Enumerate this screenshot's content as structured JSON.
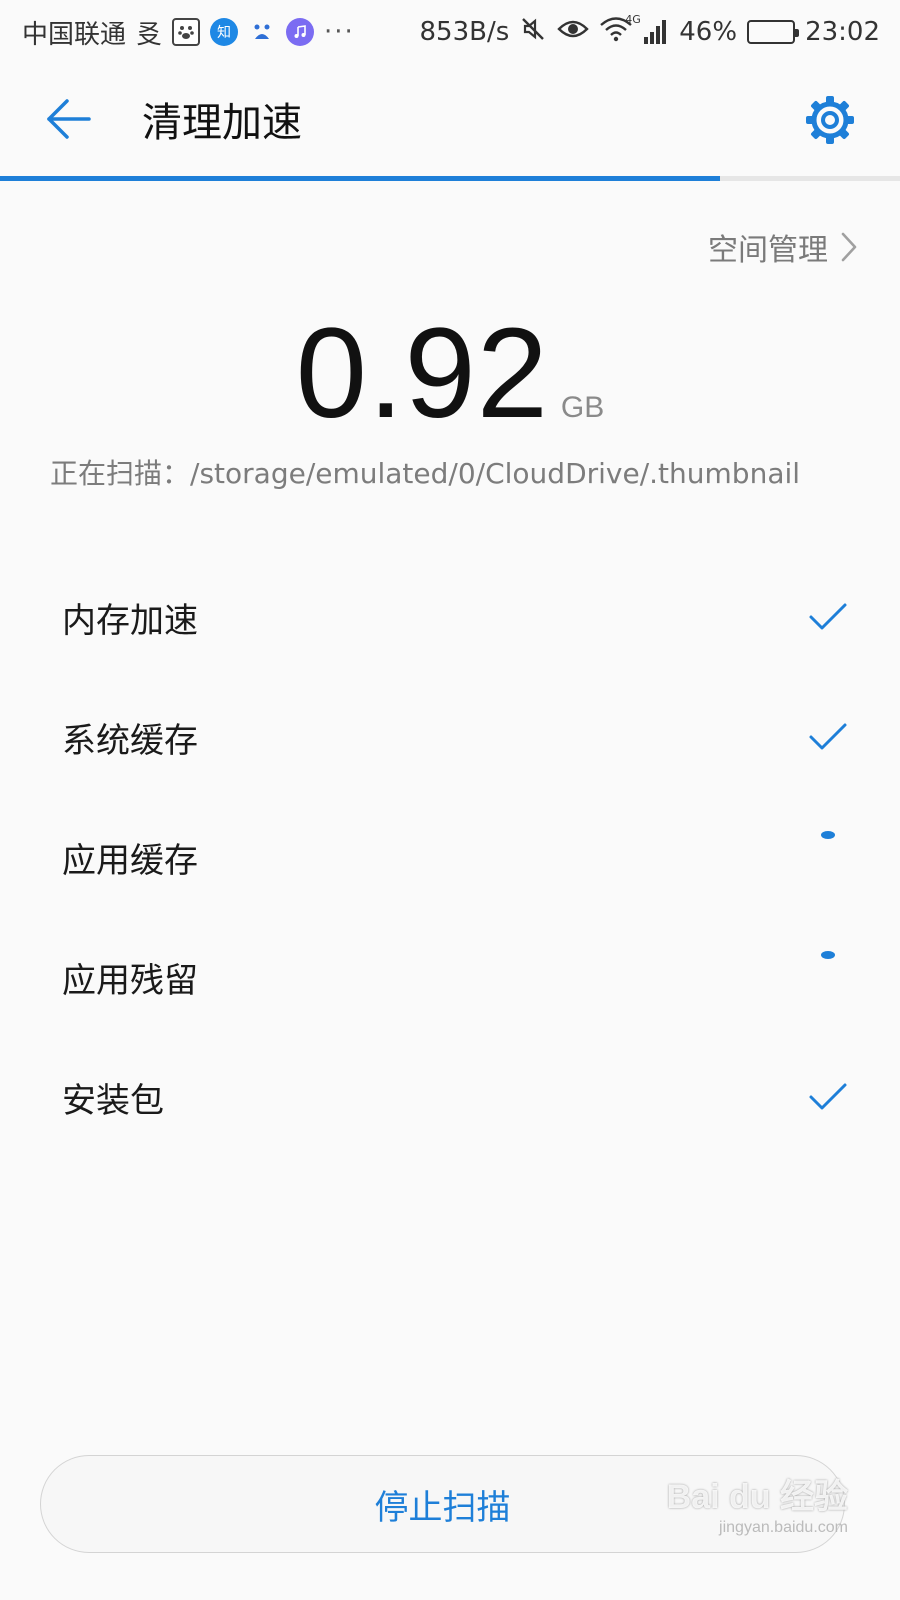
{
  "status_bar": {
    "carrier": "中国联通",
    "ime_glyph": "㕛",
    "zhihu_label": "知",
    "overflow": "···",
    "net_speed": "853B/s",
    "network": "4G",
    "battery_percent": "46%",
    "battery_level": 0.46,
    "time": "23:02",
    "icons": [
      "paw-icon",
      "zhihu-icon",
      "baidu-icon",
      "music-icon",
      "mute-icon",
      "eye-icon",
      "wifi-icon",
      "signal-icon",
      "battery-icon"
    ]
  },
  "header": {
    "title": "清理加速",
    "back_icon": "arrow-left-icon",
    "settings_icon": "gear-icon"
  },
  "progress": {
    "value": 0.8
  },
  "space_management": {
    "label": "空间管理"
  },
  "size": {
    "value": "0.92",
    "unit": "GB"
  },
  "scan": {
    "prefix": "正在扫描：",
    "path": "/storage/emulated/0/CloudDrive/.thumbnail"
  },
  "items": [
    {
      "label": "内存加速",
      "status": "done"
    },
    {
      "label": "系统缓存",
      "status": "done"
    },
    {
      "label": "应用缓存",
      "status": "scanning"
    },
    {
      "label": "应用残留",
      "status": "scanning"
    },
    {
      "label": "安装包",
      "status": "done"
    }
  ],
  "stop_button": {
    "label": "停止扫描"
  },
  "watermark": {
    "brand": "Bai du 经验",
    "url": "jingyan.baidu.com"
  },
  "colors": {
    "accent": "#1e7fd8",
    "text": "#1a1a1a",
    "muted": "#7c7c7c",
    "background": "#fafafa"
  }
}
